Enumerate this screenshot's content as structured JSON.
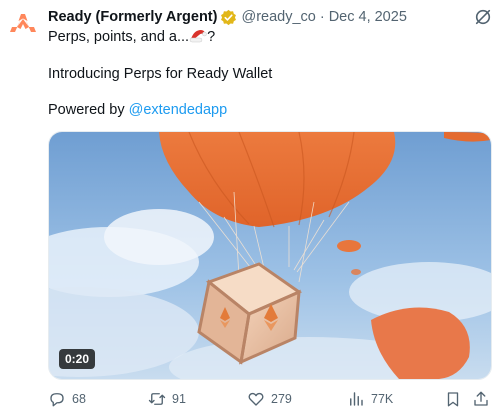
{
  "tweet": {
    "author_name": "Ready (Formerly Argent)",
    "handle": "@ready_co",
    "separator": "·",
    "date": "Dec 4, 2025",
    "line1_text": "Perps, points, and a...",
    "line1_suffix": "?",
    "line2_text": "Introducing Perps for Ready Wallet",
    "line3_prefix": "Powered by ",
    "line3_mention": "@extendedapp"
  },
  "media": {
    "duration": "0:20"
  },
  "actions": {
    "replies": "68",
    "retweets": "91",
    "likes": "279",
    "views": "77K"
  },
  "colors": {
    "brand_orange": "#ff875b",
    "verified_gold": "#e2b719",
    "link_blue": "#1d9bf0",
    "muted_gray": "#536471"
  },
  "icons": {
    "avatar": "ready-logo-icon",
    "verified": "verified-badge-icon",
    "grok": "grok-icon",
    "reply": "reply-icon",
    "retweet": "retweet-icon",
    "like": "heart-icon",
    "views": "views-chart-icon",
    "bookmark": "bookmark-icon",
    "share": "share-icon"
  }
}
